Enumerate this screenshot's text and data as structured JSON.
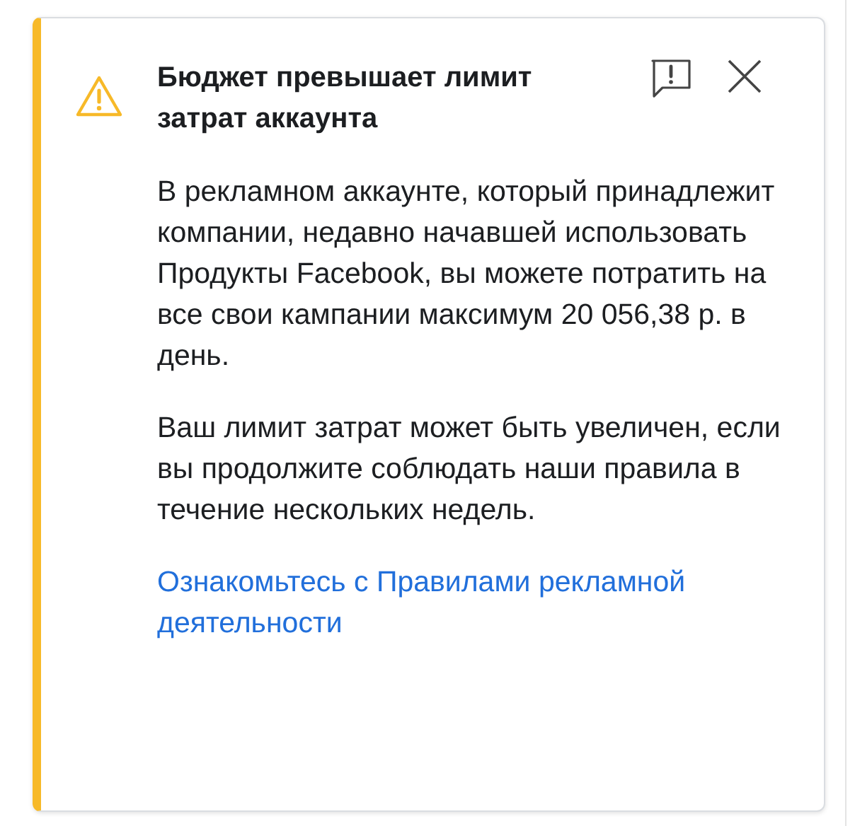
{
  "alert": {
    "title": "Бюджет превышает лимит затрат аккаунта",
    "paragraphs": [
      "В рекламном аккаунте, который принадлежит компании, недавно начавшей использовать Продукты Facebook, вы можете потратить на все свои кампании максимум 20 056,38 р. в день.",
      "Ваш лимит затрат может быть увеличен, если вы продолжите соблюдать наши правила в течение нескольких недель."
    ],
    "link": "Ознакомьтесь с Правилами рекламной деятельности"
  }
}
